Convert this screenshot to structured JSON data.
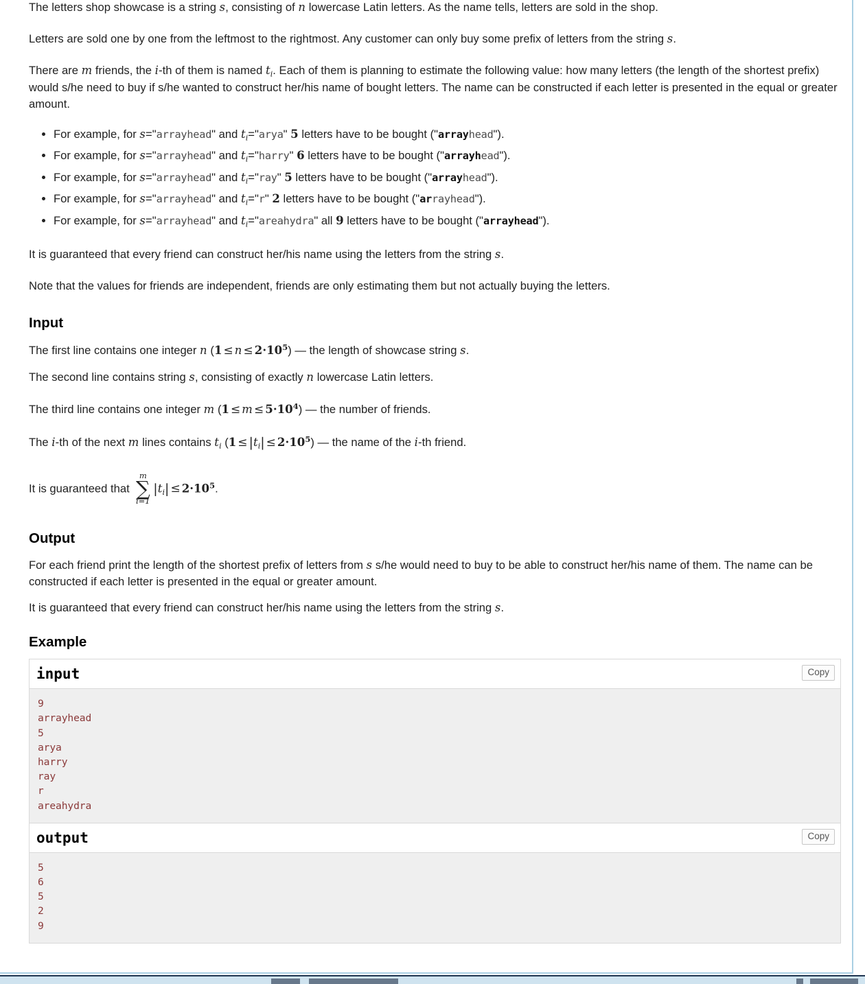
{
  "problem": {
    "intro": {
      "line1_a": "The letters shop showcase is a string ",
      "line1_s": "s",
      "line1_b": ", consisting of ",
      "line1_n": "n",
      "line1_c": " lowercase Latin letters. As the name tells, letters are sold in the shop.",
      "line2_a": "Letters are sold one by one from the leftmost to the rightmost. Any customer can only buy some prefix of letters from the string ",
      "line2_s": "s",
      "line2_b": ".",
      "line3_a": "There are ",
      "line3_m": "m",
      "line3_b": " friends, the ",
      "line3_i": "i",
      "line3_c": "-th of them is named ",
      "line3_t": "t",
      "line3_tsub": "i",
      "line3_d": ". Each of them is planning to estimate the following value: how many letters (the length of the shortest prefix) would s/he need to buy if s/he wanted to construct her/his name of bought letters. The name can be constructed if each letter is presented in the equal or greater amount."
    },
    "examples": [
      {
        "prefix": "For example, for ",
        "svar": "s",
        "eq1": "=\"",
        "sval": "arrayhead",
        "mid": "\" and ",
        "tvar": "t",
        "tsub": "i",
        "eq2": "=\"",
        "tval": "arya",
        "after_t": "\" ",
        "count": "5",
        "verb": " letters have to be bought (\"",
        "bought_bold": "array",
        "bought_rest": "head",
        "tail": "\")."
      },
      {
        "prefix": "For example, for ",
        "svar": "s",
        "eq1": "=\"",
        "sval": "arrayhead",
        "mid": "\" and ",
        "tvar": "t",
        "tsub": "i",
        "eq2": "=\"",
        "tval": "harry",
        "after_t": "\" ",
        "count": "6",
        "verb": " letters have to be bought (\"",
        "bought_bold": "arrayh",
        "bought_rest": "ead",
        "tail": "\")."
      },
      {
        "prefix": "For example, for ",
        "svar": "s",
        "eq1": "=\"",
        "sval": "arrayhead",
        "mid": "\" and ",
        "tvar": "t",
        "tsub": "i",
        "eq2": "=\"",
        "tval": "ray",
        "after_t": "\" ",
        "count": "5",
        "verb": " letters have to be bought (\"",
        "bought_bold": "array",
        "bought_rest": "head",
        "tail": "\")."
      },
      {
        "prefix": "For example, for ",
        "svar": "s",
        "eq1": "=\"",
        "sval": "arrayhead",
        "mid": "\" and ",
        "tvar": "t",
        "tsub": "i",
        "eq2": "=\"",
        "tval": "r",
        "after_t": "\" ",
        "count": "2",
        "verb": " letters have to be bought (\"",
        "bought_bold": "ar",
        "bought_rest": "rayhead",
        "tail": "\")."
      },
      {
        "prefix": "For example, for ",
        "svar": "s",
        "eq1": "=\"",
        "sval": "arrayhead",
        "mid": "\" and ",
        "tvar": "t",
        "tsub": "i",
        "eq2": "=\"",
        "tval": "areahydra",
        "after_t": "\" all ",
        "count": "9",
        "verb": " letters have to be bought (\"",
        "bought_bold": "arrayhead",
        "bought_rest": "",
        "tail": "\")."
      }
    ],
    "guarantee_a": "It is guaranteed that every friend can construct her/his name using the letters from the string ",
    "guarantee_s": "s",
    "guarantee_b": ".",
    "note": "Note that the values for friends are independent, friends are only estimating them but not actually buying the letters."
  },
  "input_section": {
    "heading": "Input",
    "p1_a": "The first line contains one integer ",
    "p1_n": "n",
    "p1_open": " (",
    "p1_one": "1",
    "p1_le1": "≤",
    "p1_n2": "n",
    "p1_le2": "≤",
    "p1_two": "2",
    "p1_dot": "·",
    "p1_ten": "10",
    "p1_exp": "5",
    "p1_close": ")",
    "p1_tail_a": " — the length of showcase string ",
    "p1_tail_s": "s",
    "p1_tail_b": ".",
    "p2_a": "The second line contains string ",
    "p2_s": "s",
    "p2_b": ", consisting of exactly ",
    "p2_n": "n",
    "p2_c": " lowercase Latin letters.",
    "p3_a": "The third line contains one integer ",
    "p3_m": "m",
    "p3_open": " (",
    "p3_one": "1",
    "p3_le1": "≤",
    "p3_m2": "m",
    "p3_le2": "≤",
    "p3_five": "5",
    "p3_dot": "·",
    "p3_ten": "10",
    "p3_exp": "4",
    "p3_close": ")",
    "p3_tail": " — the number of friends.",
    "p4_a": "The ",
    "p4_i": "i",
    "p4_b": "-th of the next ",
    "p4_m": "m",
    "p4_c": " lines contains ",
    "p4_t": "t",
    "p4_tsub": "i",
    "p4_open": " (",
    "p4_one": "1",
    "p4_le1": "≤",
    "p4_abs_open": "|",
    "p4_t2": "t",
    "p4_t2sub": "i",
    "p4_abs_close": "|",
    "p4_le2": "≤",
    "p4_two": "2",
    "p4_dot": "·",
    "p4_ten": "10",
    "p4_exp": "5",
    "p4_close": ")",
    "p4_tail_a": " — the name of the ",
    "p4_tail_i": "i",
    "p4_tail_b": "-th friend.",
    "p5_a": "It is guaranteed that ",
    "p5_sum_upper": "m",
    "p5_sum_sigma": "∑",
    "p5_sum_lower": "i=1",
    "p5_abs_open": "|",
    "p5_t": "t",
    "p5_tsub": "i",
    "p5_abs_close": "|",
    "p5_le": "≤",
    "p5_two": "2",
    "p5_dot": "·",
    "p5_ten": "10",
    "p5_exp": "5",
    "p5_period": "."
  },
  "output_section": {
    "heading": "Output",
    "p1_a": "For each friend print the length of the shortest prefix of letters from ",
    "p1_s": "s",
    "p1_b": " s/he would need to buy to be able to construct her/his name of them. The name can be constructed if each letter is presented in the equal or greater amount.",
    "p2_a": "It is guaranteed that every friend can construct her/his name using the letters from the string ",
    "p2_s": "s",
    "p2_b": "."
  },
  "example_section": {
    "heading": "Example",
    "input": {
      "title": "input",
      "copy_label": "Copy",
      "data": "9\narrayhead\n5\narya\nharry\nray\nr\nareahydra"
    },
    "output": {
      "title": "output",
      "copy_label": "Copy",
      "data": "5\n6\n5\n2\n9"
    }
  },
  "colors": {
    "sample_text": "#8b3a3a",
    "sample_bg": "#efefef",
    "border": "#d9d9d9",
    "frame": "#a9cfe3"
  }
}
